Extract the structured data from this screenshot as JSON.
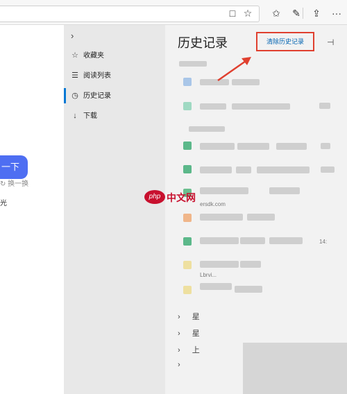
{
  "toolbar": {
    "icons": [
      "reading-view-icon",
      "favorite-star-icon",
      "favorites-list-icon",
      "notes-pen-icon",
      "share-icon",
      "more-icon"
    ],
    "more_label": "···"
  },
  "page": {
    "search_button_label": "一下",
    "refresh_label": "换一换",
    "hint_text": "光"
  },
  "hub": {
    "items": [
      {
        "label": "收藏夹",
        "icon": "star-icon"
      },
      {
        "label": "阅读列表",
        "icon": "reading-list-icon"
      },
      {
        "label": "历史记录",
        "icon": "history-icon",
        "active": true
      },
      {
        "label": "下载",
        "icon": "download-icon"
      }
    ]
  },
  "history": {
    "title": "历史记录",
    "clear_button": "清除历史记录",
    "row_times": [
      "14:",
      "14"
    ],
    "row_fragments": [
      "ersdk.com",
      "Lbrvi..."
    ],
    "groups": [
      "星",
      "星",
      "上",
      ""
    ]
  },
  "watermark": {
    "badge": "php",
    "text": "中文网"
  },
  "colors": {
    "accent": "#0078d4",
    "clear_border": "#e0402f",
    "search_button": "#4e6ef2"
  }
}
